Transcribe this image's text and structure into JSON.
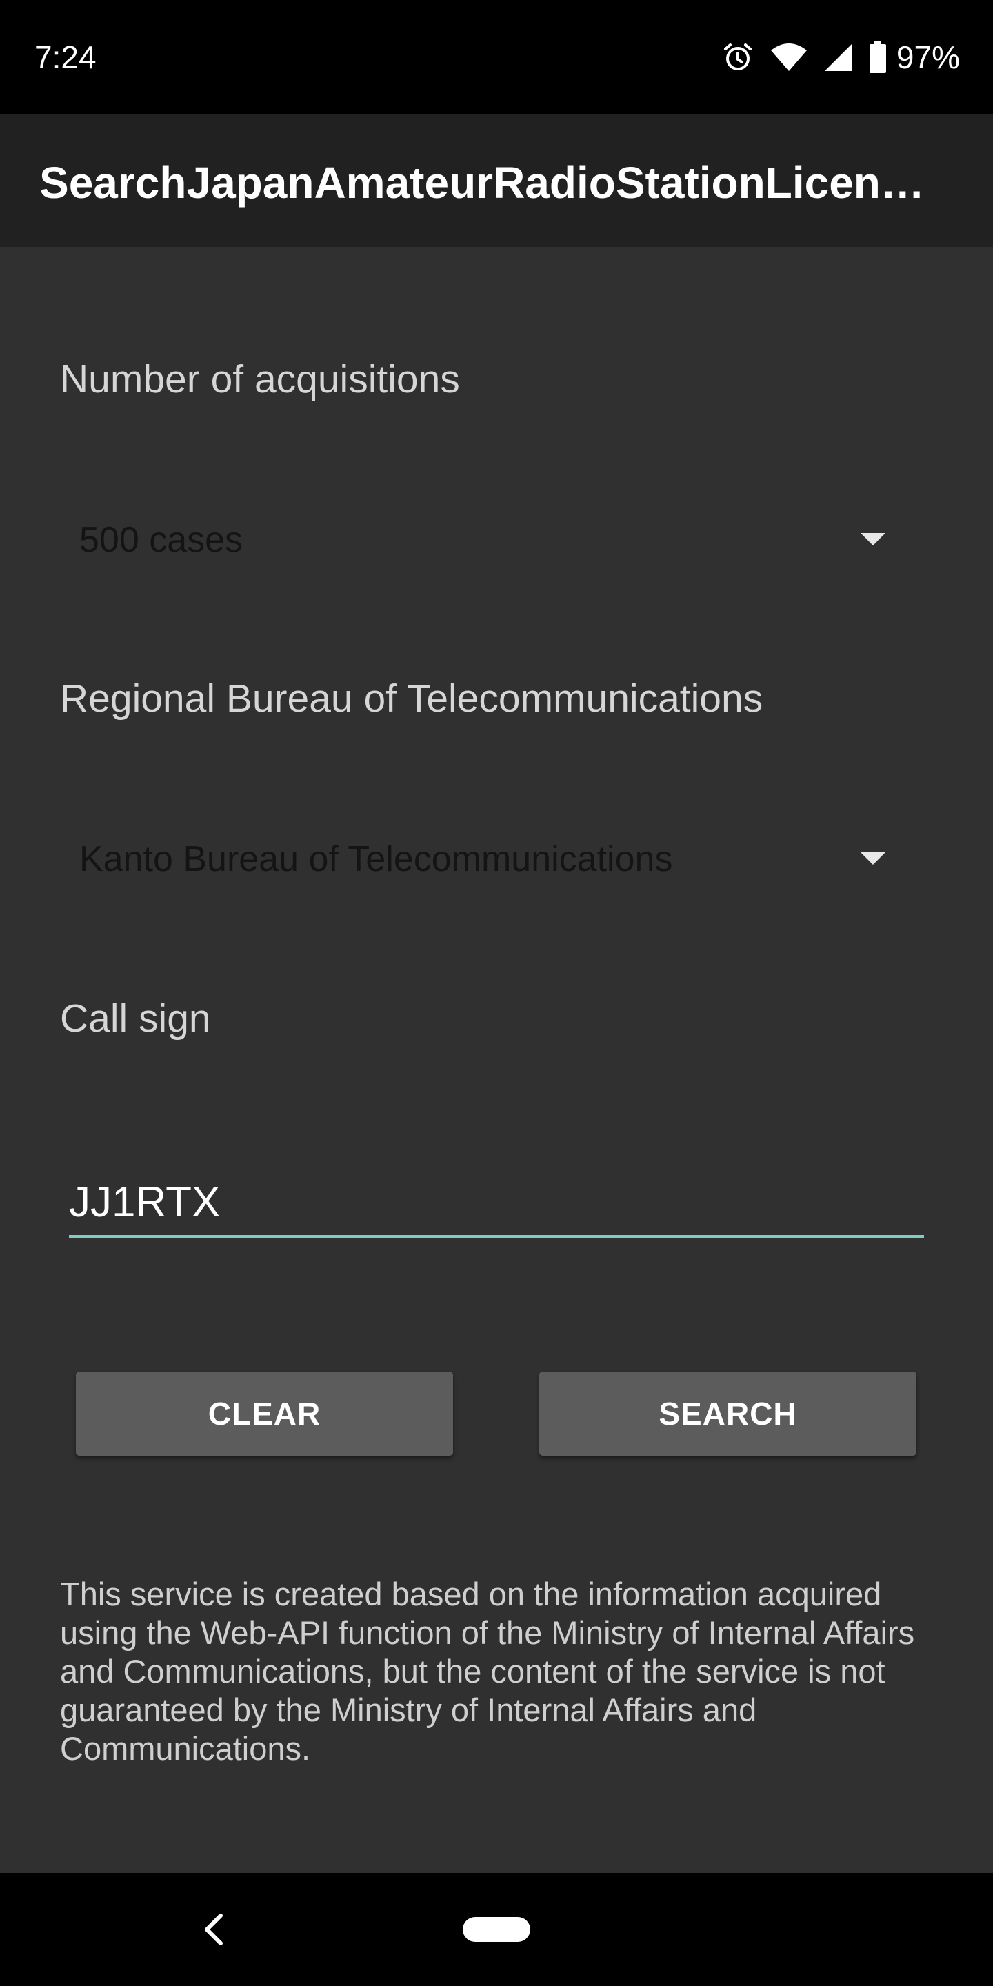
{
  "status_bar": {
    "time": "7:24",
    "battery_percent": "97%",
    "icons": [
      "alarm-icon",
      "wifi-icon",
      "cell-signal-icon",
      "battery-icon"
    ]
  },
  "app_bar": {
    "title": "SearchJapanAmateurRadioStationLicense"
  },
  "form": {
    "acquisitions": {
      "label": "Number of acquisitions",
      "selected": "500 cases"
    },
    "bureau": {
      "label": "Regional Bureau of Telecommunications",
      "selected": "Kanto Bureau of Telecommunications"
    },
    "call_sign": {
      "label": "Call sign",
      "value": "JJ1RTX"
    },
    "buttons": {
      "clear": "CLEAR",
      "search": "SEARCH"
    }
  },
  "disclaimer": "This service is created based on the information acquired using the Web-API function of the Ministry of Internal Affairs and Communications, but the content of the service is not guaranteed by the Ministry of Internal Affairs and Communications.",
  "colors": {
    "background": "#303030",
    "app_bar": "#212121",
    "accent_underline": "#80cbc4",
    "button": "#5c5c5c"
  }
}
